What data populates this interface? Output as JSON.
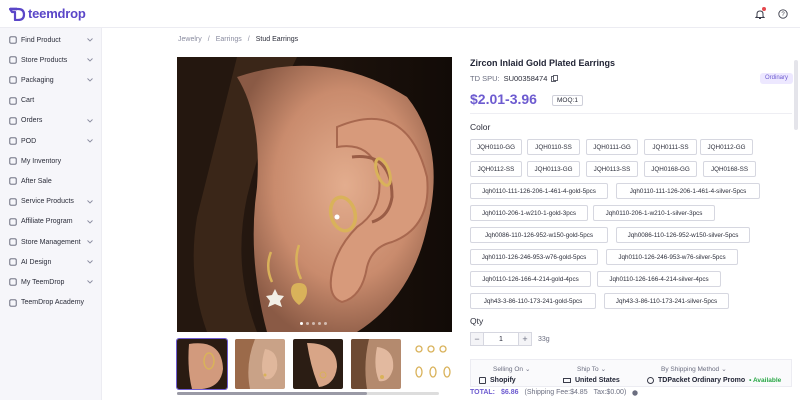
{
  "header": {
    "brand": "teemdrop",
    "icons": [
      "bell-icon",
      "help-icon"
    ],
    "brand_color": "#5a46c8"
  },
  "sidebar": {
    "items": [
      {
        "label": "Find Product",
        "icon": "search-icon",
        "expandable": true
      },
      {
        "label": "Store Products",
        "icon": "store-icon",
        "expandable": true
      },
      {
        "label": "Packaging",
        "icon": "package-icon",
        "expandable": true
      },
      {
        "label": "Cart",
        "icon": "cart-icon",
        "expandable": false
      },
      {
        "label": "Orders",
        "icon": "orders-icon",
        "expandable": true
      },
      {
        "label": "POD",
        "icon": "pod-icon",
        "expandable": true
      },
      {
        "label": "My Inventory",
        "icon": "inventory-icon",
        "expandable": false
      },
      {
        "label": "After Sale",
        "icon": "aftersale-icon",
        "expandable": false
      },
      {
        "label": "Service Products",
        "icon": "service-icon",
        "expandable": true
      },
      {
        "label": "Affiliate Program",
        "icon": "affiliate-icon",
        "expandable": true
      },
      {
        "label": "Store Management",
        "icon": "store-management-icon",
        "expandable": true
      },
      {
        "label": "AI Design",
        "icon": "ai-icon",
        "expandable": true
      },
      {
        "label": "My TeemDrop",
        "icon": "user-icon",
        "expandable": true
      },
      {
        "label": "TeemDrop Academy",
        "icon": "academy-icon",
        "expandable": false
      }
    ]
  },
  "breadcrumb": {
    "items": [
      "Jewelry",
      "Earrings",
      "Stud Earrings"
    ],
    "separator": "/"
  },
  "product": {
    "title": "Zircon Inlaid Gold Plated Earrings",
    "spu_label": "TD SPU:",
    "spu_value": "SU00358474",
    "badge": "Ordinary",
    "price": "$2.01-3.96",
    "moq": "MOQ:1",
    "color_label": "Color",
    "colors": [
      "JQH0110-GG",
      "JQH0110-SS",
      "JQH0111-GG",
      "JQH0111-SS",
      "JQH0112-GG",
      "JQH0112-SS",
      "JQH0113-GG",
      "JQH0113-SS",
      "JQH0168-GG",
      "JQH0168-SS",
      "Jqh0110-111-126-206-1-461-4-gold-5pcs",
      "Jqh0110-111-126-206-1-461-4-silver-5pcs",
      "Jqh0110-206-1-w210-1-gold-3pcs",
      "Jqh0110-206-1-w210-1-silver-3pcs",
      "Jqh0086-110-126-952-w150-gold-5pcs",
      "Jqh0086-110-126-952-w150-silver-5pcs",
      "Jqh0110-126-246-953-w76-gold-5pcs",
      "Jqh0110-126-246-953-w76-silver-5pcs",
      "Jqh0110-126-166-4-214-gold-4pcs",
      "Jqh0110-126-166-4-214-silver-4pcs",
      "Jqh43-3-86-110-173-241-gold-5pcs",
      "Jqh43-3-86-110-173-241-silver-5pcs"
    ],
    "qty_label": "Qty",
    "qty_value": "1",
    "weight": "33g",
    "accent_color": "#6d5bd0"
  },
  "shipping": {
    "selling_on_label": "Selling On",
    "selling_on_value": "Shopify",
    "ship_to_label": "Ship To",
    "ship_to_value": "United States",
    "method_label": "By Shipping Method",
    "method_value": "TDPacket Ordinary Promo",
    "availability": "Available"
  },
  "total": {
    "label": "TOTAL:",
    "amount": "$6.86",
    "shipping_fee": "(Shipping Fee:$4.85",
    "tax": "Tax:$0.00)"
  },
  "gallery": {
    "thumbnails": 5,
    "dots": 5,
    "active_dot": 0
  }
}
